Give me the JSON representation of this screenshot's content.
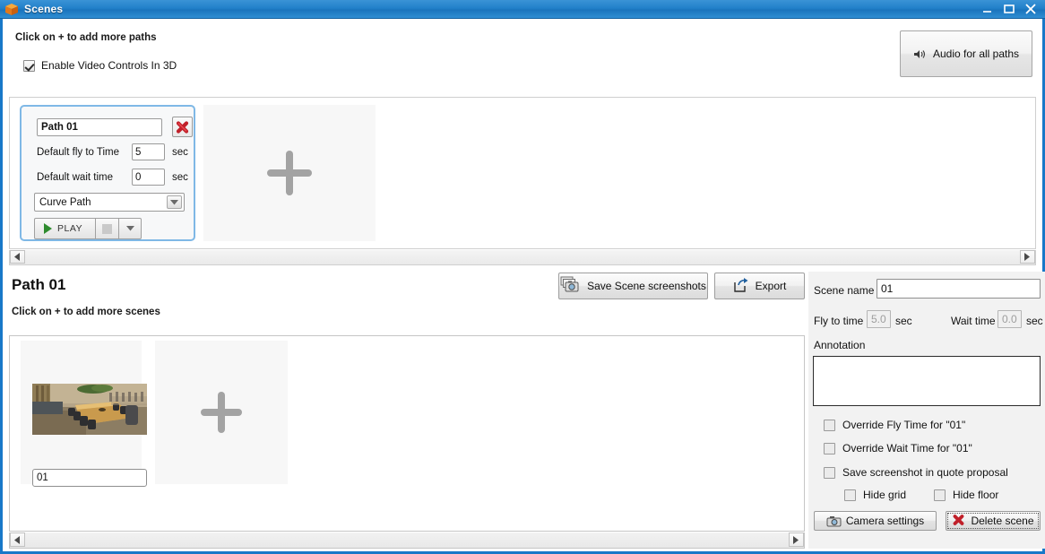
{
  "window": {
    "title": "Scenes",
    "icon": "box-3d-icon",
    "minimize_label": "–",
    "maximize_label": "□",
    "close_label": "✕",
    "border_color": "#1878c8"
  },
  "header": {
    "hint": "Click on + to add more paths",
    "enable_video_controls": {
      "label": "Enable Video Controls In 3D",
      "checked": true
    },
    "audio_button": {
      "label": "Audio for all paths",
      "icon": "speaker-icon"
    }
  },
  "paths": {
    "card": {
      "name_value": "Path 01",
      "delete_icon": "red-x-icon",
      "fly_to_time_label": "Default fly to Time",
      "fly_to_time_value": "5",
      "fly_to_time_unit": "sec",
      "wait_time_label": "Default wait time",
      "wait_time_value": "0",
      "wait_time_unit": "sec",
      "path_type_value": "Curve Path",
      "play_label": "PLAY"
    },
    "add_tile": {
      "icon": "plus-icon"
    }
  },
  "path_detail": {
    "title": "Path 01",
    "hint": "Click on + to add more scenes",
    "save_screenshots_label": "Save Scene screenshots",
    "save_screenshots_icon": "camera-stack-icon",
    "export_label": "Export",
    "export_icon": "export-arrow-icon"
  },
  "scenes": {
    "items": [
      {
        "name_value": "01",
        "thumbnail": "conference-room-thumbnail"
      }
    ],
    "add_tile": {
      "icon": "plus-icon"
    }
  },
  "properties": {
    "scene_name_label": "Scene name",
    "scene_name_value": "01",
    "fly_to_time_label": "Fly to time",
    "fly_to_time_value": "5.0",
    "fly_to_time_unit": "sec",
    "wait_time_label": "Wait time",
    "wait_time_value": "0.0",
    "wait_time_unit": "sec",
    "annotation_label": "Annotation",
    "annotation_value": "",
    "checkboxes": [
      {
        "label": "Override Fly Time for \"01\"",
        "checked": false
      },
      {
        "label": "Override Wait Time for \"01\"",
        "checked": false
      },
      {
        "label": "Save screenshot in quote proposal",
        "checked": false
      },
      {
        "label": "Hide grid",
        "checked": false
      },
      {
        "label": "Hide floor",
        "checked": false
      }
    ],
    "camera_settings_label": "Camera settings",
    "camera_settings_icon": "camera-icon",
    "delete_scene_label": "Delete scene",
    "delete_scene_icon": "red-x-icon"
  },
  "scrollbars": {
    "left_arrow": "◀",
    "right_arrow": "▶"
  }
}
